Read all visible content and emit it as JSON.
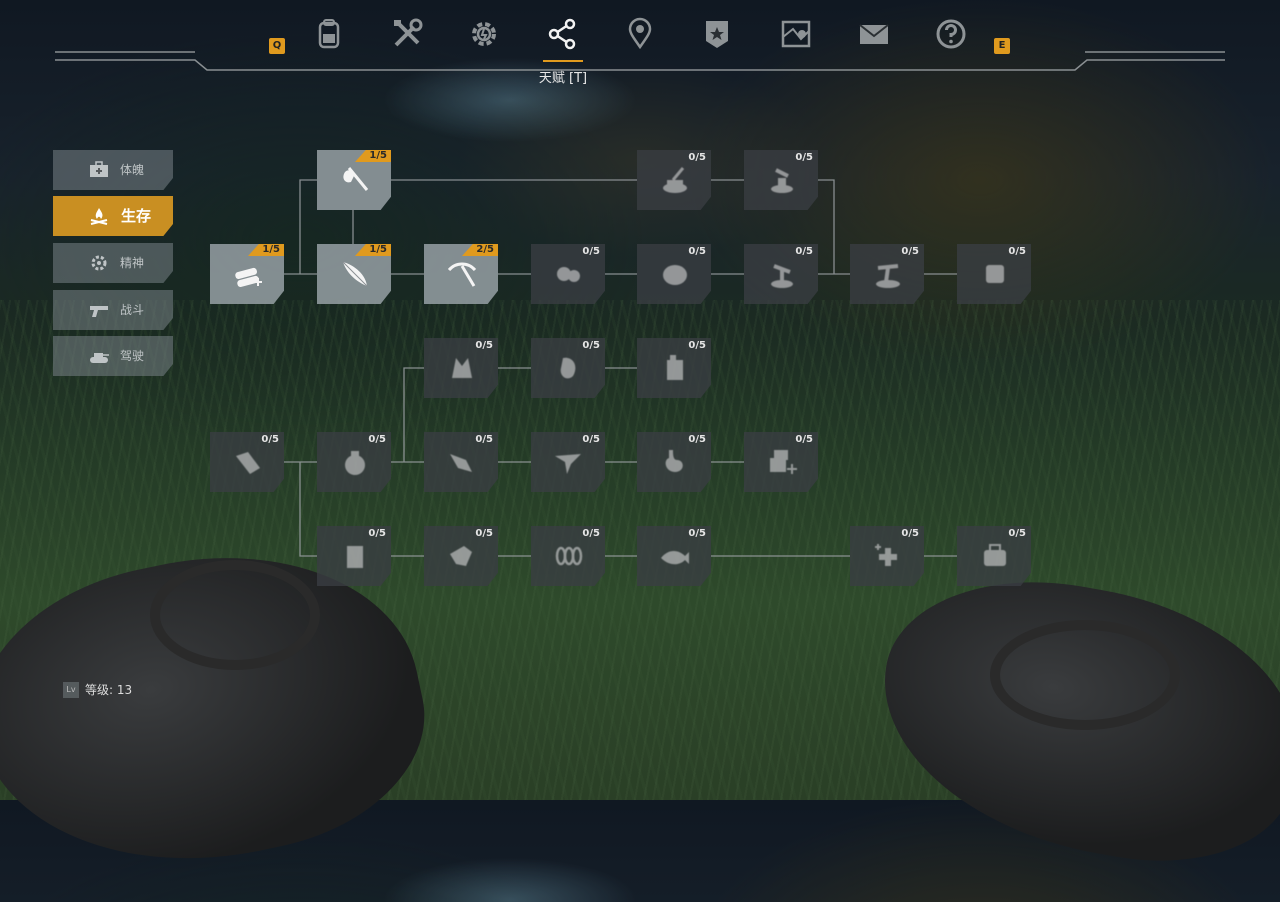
{
  "nav": {
    "prev_key": "Q",
    "next_key": "E",
    "tabs": [
      {
        "icon": "backpack-icon"
      },
      {
        "icon": "crafting-tools-icon"
      },
      {
        "icon": "gear-icon"
      },
      {
        "icon": "talent-share-icon",
        "active": true
      },
      {
        "icon": "map-pin-icon"
      },
      {
        "icon": "rank-badge-icon"
      },
      {
        "icon": "map-icon"
      },
      {
        "icon": "mail-icon"
      },
      {
        "icon": "help-icon"
      }
    ],
    "active_title": "天赋 [T]"
  },
  "sidebar": {
    "items": [
      {
        "label": "体魄",
        "icon": "first-aid-kit-icon"
      },
      {
        "label": "生存",
        "icon": "campfire-icon",
        "active": true
      },
      {
        "label": "精神",
        "icon": "brain-gear-icon"
      },
      {
        "label": "战斗",
        "icon": "pistol-icon"
      },
      {
        "label": "驾驶",
        "icon": "tank-icon"
      }
    ]
  },
  "skills": [
    {
      "id": "s1",
      "count": "1/5",
      "icon": "axe-icon",
      "lit": true
    },
    {
      "id": "s2",
      "count": "0/5",
      "icon": "stump-axe-icon"
    },
    {
      "id": "s3",
      "count": "0/5",
      "icon": "stump-axe-2-icon"
    },
    {
      "id": "s4",
      "count": "1/5",
      "icon": "logs-icon",
      "lit": true
    },
    {
      "id": "s5",
      "count": "1/5",
      "icon": "feather-icon",
      "lit": true
    },
    {
      "id": "s6",
      "count": "2/5",
      "icon": "pickaxe-icon",
      "lit": true
    },
    {
      "id": "s7",
      "count": "0/5",
      "icon": "rocks-icon"
    },
    {
      "id": "s8",
      "count": "0/5",
      "icon": "stone-icon"
    },
    {
      "id": "s9",
      "count": "0/5",
      "icon": "mining-icon"
    },
    {
      "id": "s10",
      "count": "0/5",
      "icon": "mining-2-icon"
    },
    {
      "id": "s11",
      "count": "0/5",
      "icon": "ore-icon"
    },
    {
      "id": "s12",
      "count": "0/5",
      "icon": "wolf-head-icon"
    },
    {
      "id": "s13",
      "count": "0/5",
      "icon": "meat-icon"
    },
    {
      "id": "s14",
      "count": "0/5",
      "icon": "canister-icon"
    },
    {
      "id": "s15",
      "count": "0/5",
      "icon": "cloth-icon"
    },
    {
      "id": "s16",
      "count": "0/5",
      "icon": "sack-icon"
    },
    {
      "id": "s17",
      "count": "0/5",
      "icon": "grab-icon"
    },
    {
      "id": "s18",
      "count": "0/5",
      "icon": "bird-icon"
    },
    {
      "id": "s19",
      "count": "0/5",
      "icon": "stomach-icon"
    },
    {
      "id": "s20",
      "count": "0/5",
      "icon": "crate-icon"
    },
    {
      "id": "s21",
      "count": "0/5",
      "icon": "box-icon"
    },
    {
      "id": "s22",
      "count": "0/5",
      "icon": "hand-icon"
    },
    {
      "id": "s23",
      "count": "0/5",
      "icon": "chain-icon"
    },
    {
      "id": "s24",
      "count": "0/5",
      "icon": "fish-icon"
    },
    {
      "id": "s25",
      "count": "0/5",
      "icon": "medical-icon"
    },
    {
      "id": "s26",
      "count": "0/5",
      "icon": "bag-icon"
    }
  ],
  "level": {
    "badge": "Lv",
    "text": "等级: 13"
  }
}
